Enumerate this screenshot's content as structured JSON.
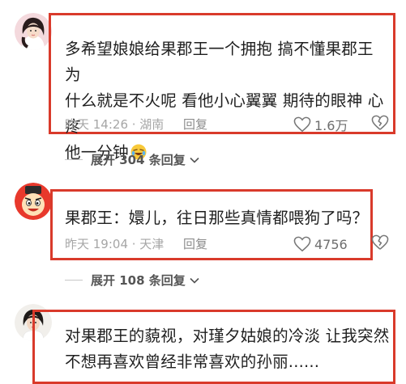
{
  "comments": [
    {
      "text_lines": [
        "多希望娘娘给果郡王一个拥抱  搞不懂果郡王为",
        "什么就是不火呢 看他小心翼翼 期待的眼神 心疼",
        "他一分钟"
      ],
      "emoji": "laughing-crying-emoji",
      "time": "昨天 14:26 · 湖南",
      "reply_label": "回复",
      "likes": "1.6万"
    },
    {
      "text_lines": [
        "果郡王：嬛儿，往日那些真情都喂狗了吗？"
      ],
      "time": "昨天 19:04 · 天津",
      "reply_label": "回复",
      "likes": "4756"
    },
    {
      "text_lines": [
        "对果郡王的藐视，对瑾夕姑娘的冷淡 让我突然",
        "不想再喜欢曾经非常喜欢的孙丽......"
      ]
    }
  ],
  "expand_1": "展开 304 条回复",
  "expand_2": "展开 108 条回复",
  "colors": {
    "highlight_border": "#d93a2b",
    "meta_gray": "#a6a6a6"
  }
}
